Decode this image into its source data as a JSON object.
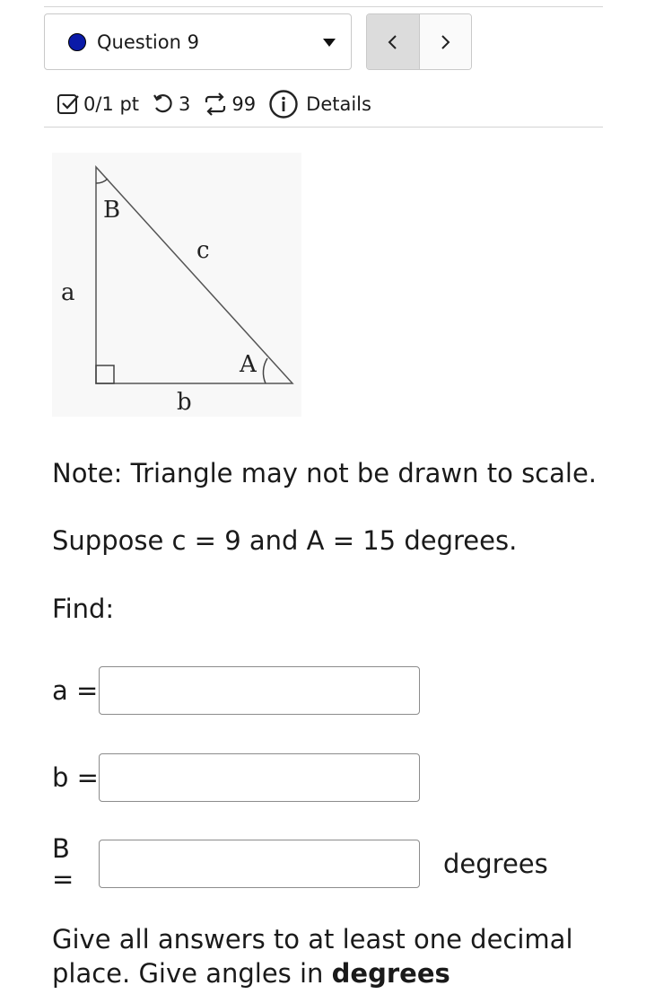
{
  "header": {
    "question_label": "Question 9",
    "status_color": "#0a1aa8"
  },
  "nav": {
    "prev_icon": "chevron-left-icon",
    "next_icon": "chevron-right-icon",
    "prev_glyph": "‹",
    "next_glyph": "›"
  },
  "meta": {
    "score": "0/1 pt",
    "retries": "3",
    "attempts": "99",
    "details_label": "Details"
  },
  "figure": {
    "labels": {
      "vertex_b": "B",
      "vertex_a": "A",
      "side_a": "a",
      "side_b": "b",
      "side_c": "c"
    }
  },
  "content": {
    "note": "Note: Triangle may not be drawn to scale.",
    "given": "Suppose c = 9 and A = 15 degrees.",
    "find": "Find:"
  },
  "answers": [
    {
      "label": "a =",
      "value": "",
      "unit": ""
    },
    {
      "label": "b =",
      "value": "",
      "unit": ""
    },
    {
      "label": "B =",
      "value": "",
      "unit": "degrees"
    }
  ],
  "footer": {
    "text": "Give all answers to at least one decimal place. Give angles in ",
    "emphasis": "degrees"
  }
}
